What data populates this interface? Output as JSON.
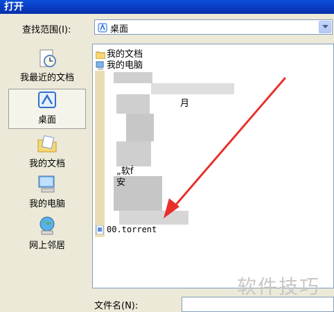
{
  "window": {
    "title": "打开"
  },
  "look_in": {
    "label": "查找范围(I):",
    "value": "桌面"
  },
  "places": [
    {
      "label": "我最近的文档",
      "icon": "recent-docs-icon"
    },
    {
      "label": "桌面",
      "icon": "desktop-icon"
    },
    {
      "label": "我的文档",
      "icon": "my-documents-icon"
    },
    {
      "label": "我的电脑",
      "icon": "my-computer-icon"
    },
    {
      "label": "网上邻居",
      "icon": "network-places-icon"
    }
  ],
  "files": [
    {
      "name": "我的文档",
      "icon": "folder-docs-icon"
    },
    {
      "name": "我的电脑",
      "icon": "computer-icon"
    },
    {
      "name": "月",
      "icon": "blurred-icon"
    },
    {
      "name": "„软ḟ",
      "icon": "blurred-icon"
    },
    {
      "name": "安",
      "icon": "blurred-icon"
    },
    {
      "name": "00.torrent",
      "icon": "torrent-file-icon"
    }
  ],
  "filename": {
    "label": "文件名(N):",
    "value": ""
  },
  "watermark": "软件技巧",
  "colors": {
    "titlebar": "#0a3bc4",
    "accent_arrow": "#e8302a",
    "background": "#ece9d8"
  }
}
